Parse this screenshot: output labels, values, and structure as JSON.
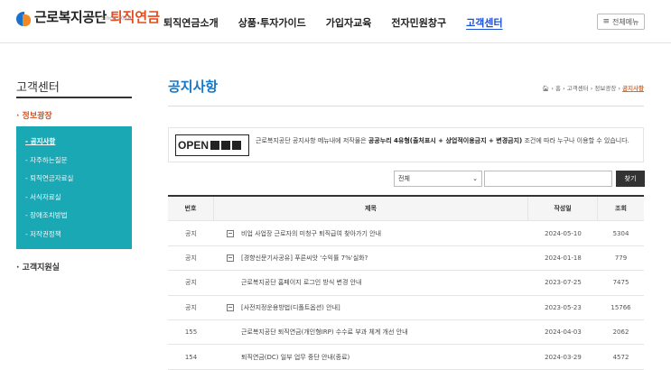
{
  "header": {
    "logo_main": "근로복지공단",
    "logo_sub": "퇴직연금",
    "logo_since": "Since 2010",
    "nav": [
      {
        "label": "퇴직연금소개",
        "active": false
      },
      {
        "label": "상품·투자가이드",
        "active": false
      },
      {
        "label": "가입자교육",
        "active": false
      },
      {
        "label": "전자민원창구",
        "active": false
      },
      {
        "label": "고객센터",
        "active": true
      }
    ],
    "all_menu_label": "전체메뉴"
  },
  "sidebar": {
    "title": "고객센터",
    "section1": "· 정보광장",
    "items": [
      {
        "label": "- 공지사항",
        "active": true
      },
      {
        "label": "- 자주하는질문",
        "active": false
      },
      {
        "label": "- 퇴직연금자료실",
        "active": false
      },
      {
        "label": "- 서식자료실",
        "active": false
      },
      {
        "label": "- 장애조치방법",
        "active": false
      },
      {
        "label": "- 저작권정책",
        "active": false
      }
    ],
    "section2": "· 고객지원실"
  },
  "main": {
    "title": "공지사항",
    "breadcrumb": {
      "home": "홈",
      "path1": "고객센터",
      "path2": "정보광장",
      "current": "공지사항"
    },
    "open_license": {
      "logo_text": "OPEN",
      "text_pre": "근로복지공단 공지사항 메뉴내에 저작물은 ",
      "text_bold": "공공누리 4유형(출처표시 + 상업적이용금지 + 변경금지)",
      "text_post": " 조건에 따라 누구나 이용할 수 있습니다."
    },
    "search": {
      "select_value": "전체",
      "input_value": "",
      "button_label": "찾기"
    },
    "table": {
      "headers": {
        "no": "번호",
        "title": "제목",
        "date": "작성일",
        "views": "조회"
      },
      "rows": [
        {
          "no": "공지",
          "title": "비업 사업장 근로자의 미청구 퇴직급여 찾아가기 안내",
          "date": "2024-05-10",
          "views": "5304",
          "icon": true
        },
        {
          "no": "공지",
          "title": "[경향신문기사공유] 푸른씨앗 '수익률 7%'실화?",
          "date": "2024-01-18",
          "views": "779",
          "icon": true
        },
        {
          "no": "공지",
          "title": "근로복지공단 홈페이지 로그인 방식 변경 안내",
          "date": "2023-07-25",
          "views": "7475",
          "icon": false
        },
        {
          "no": "공지",
          "title": "[사전지정운용방법(디폴트옵션) 안내]",
          "date": "2023-05-23",
          "views": "15766",
          "icon": true
        },
        {
          "no": "155",
          "title": "근로복지공단 퇴직연금(개인형IRP) 수수료 부과 체계 개선 안내",
          "date": "2024-04-03",
          "views": "2062",
          "icon": false
        },
        {
          "no": "154",
          "title": "퇴직연금(DC) 일부 업무 중단 안내(종료)",
          "date": "2024-03-29",
          "views": "4572",
          "icon": false
        }
      ]
    }
  }
}
